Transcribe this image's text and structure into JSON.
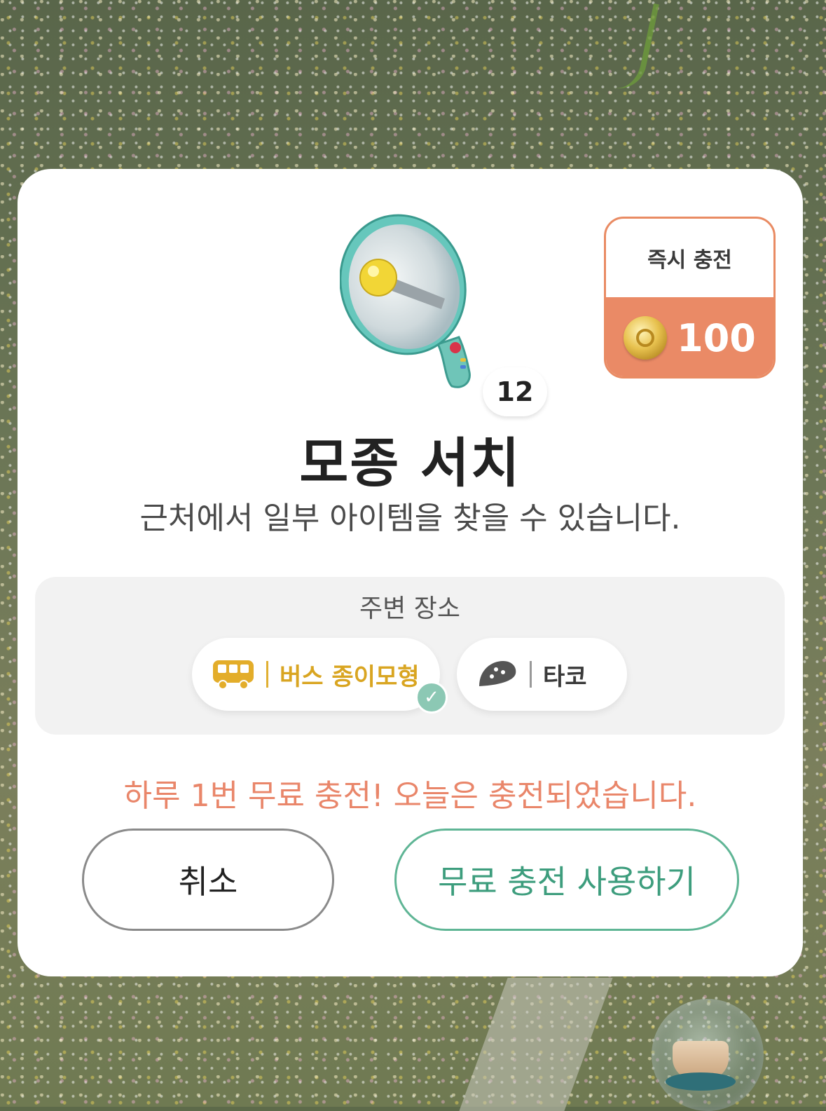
{
  "dialog": {
    "instant_charge": {
      "label": "즉시 충전",
      "price": "100",
      "currency_icon": "coin-icon"
    },
    "item": {
      "icon": "megaphone-icon",
      "count": "12",
      "title": "모종 서치",
      "description": "근처에서 일부 아이템을 찾을 수 있습니다."
    },
    "nearby": {
      "label": "주변 장소",
      "places": [
        {
          "icon": "bus-icon",
          "label": "버스 종이모형",
          "selected": true
        },
        {
          "icon": "taco-icon",
          "label": "타코",
          "selected": false
        }
      ]
    },
    "notice": "하루 1번 무료 충전! 오늘은 충전되었습니다.",
    "buttons": {
      "cancel": "취소",
      "use_free": "무료 충전 사용하기"
    }
  },
  "colors": {
    "accent_orange": "#ea8a66",
    "accent_green": "#5fb595",
    "highlight_gold": "#d9a521"
  }
}
